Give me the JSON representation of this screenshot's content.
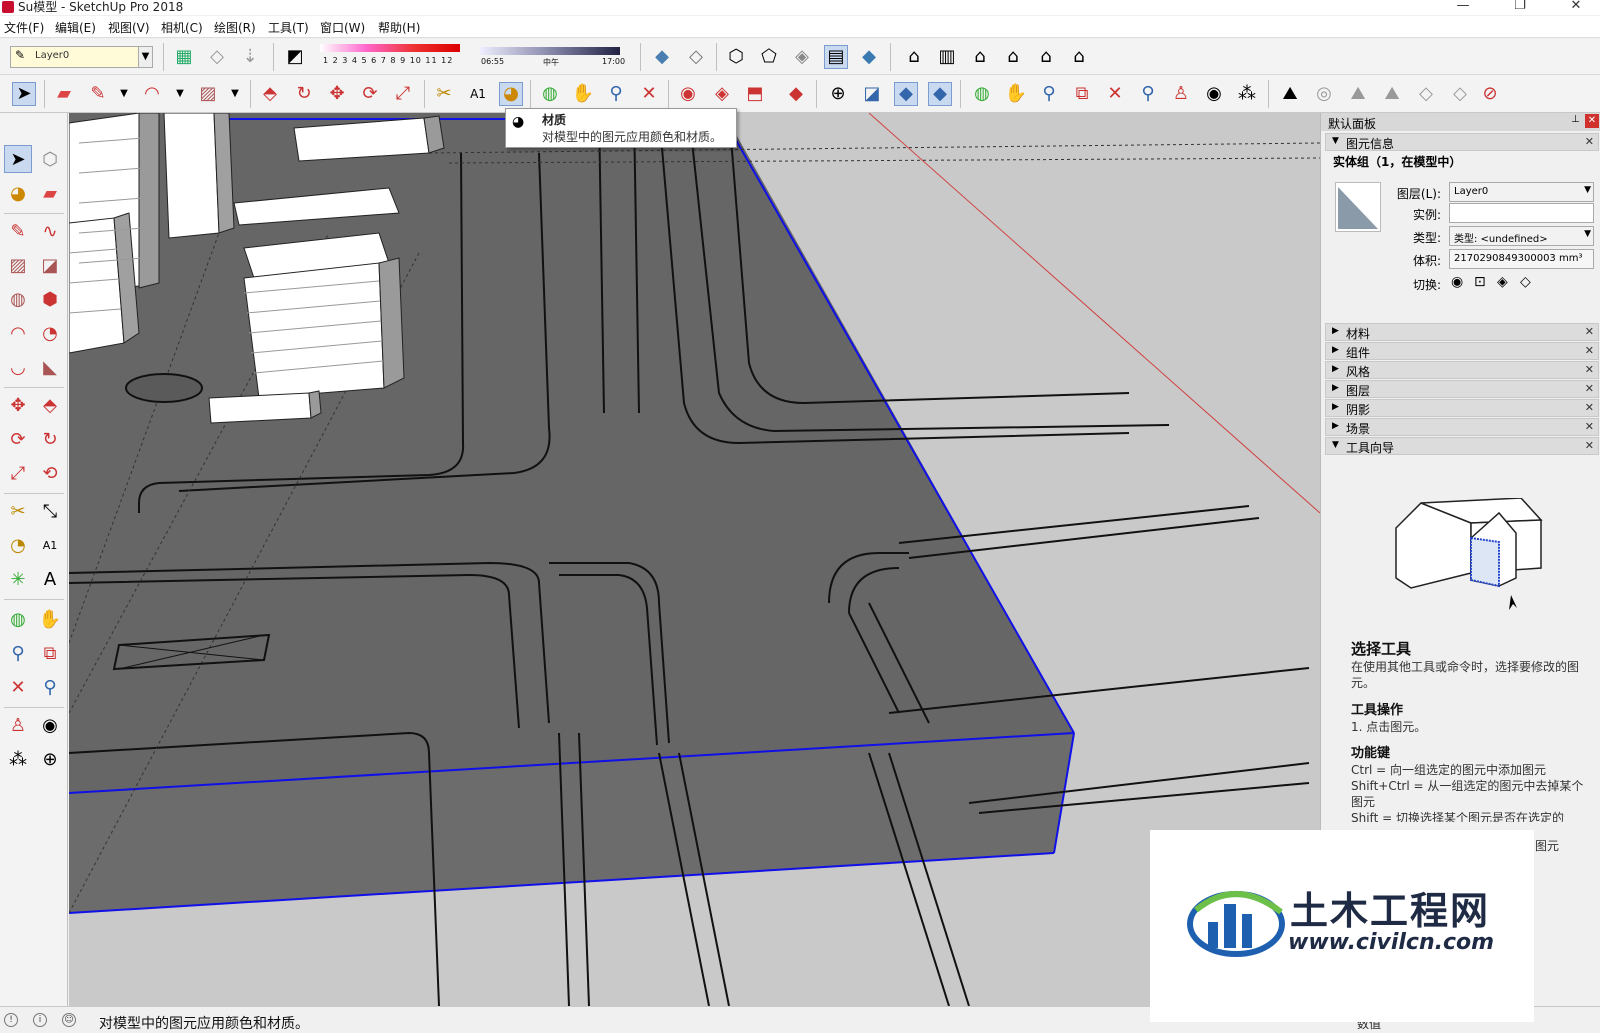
{
  "window": {
    "title": "Su模型 - SketchUp Pro 2018",
    "min": "—",
    "restore": "❐",
    "close": "✕"
  },
  "menu": [
    "文件(F)",
    "编辑(E)",
    "视图(V)",
    "相机(C)",
    "绘图(R)",
    "工具(T)",
    "窗口(W)",
    "帮助(H)"
  ],
  "toolbar": {
    "layer_value": "Layer0",
    "shadow_month_nums": "1 2 3 4 5 6 7 8 9 10 11 12",
    "shadow_time_start": "06:55",
    "shadow_time_mid": "中午",
    "shadow_time_end": "17:00"
  },
  "tooltip": {
    "title": "材质",
    "desc": "对模型中的图元应用颜色和材质。"
  },
  "panel": {
    "title": "默认面板",
    "entity_info": {
      "header": "图元信息",
      "heading": "实体组（1，在模型中）",
      "layer_label": "图层(L):",
      "layer_value": "Layer0",
      "instance_label": "实例:",
      "instance_value": "",
      "type_label": "类型:",
      "type_value": "类型: <undefined>",
      "volume_label": "体积:",
      "volume_value": "2170290849300003 mm³",
      "toggle_label": "切换:"
    },
    "trays": [
      "材料",
      "组件",
      "风格",
      "图层",
      "阴影",
      "场景"
    ],
    "guide_header": "工具向导",
    "guide": {
      "title": "选择工具",
      "desc": "在使用其他工具或命令时，选择要修改的图元。",
      "ops_title": "工具操作",
      "ops_1": "1. 点击图元。",
      "keys_title": "功能键",
      "key_1": "Ctrl = 向一组选定的图元中添加图元",
      "key_2": "Shift+Ctrl = 从一组选定的图元中去掉某个图元",
      "key_3_partial": "Shift = 切换选择某个图元是否在选定的",
      "key_3_tail": "图元"
    }
  },
  "status": {
    "message": "对模型中的图元应用颜色和材质。",
    "value_label": "数值"
  },
  "watermark": {
    "name": "土木工程网",
    "url": "www.civilcn.com"
  },
  "colors": {
    "ground_dark": "#666666",
    "ground_light": "#c9c9c9",
    "selection_blue": "#1010e8",
    "axis_red": "#d04040"
  }
}
